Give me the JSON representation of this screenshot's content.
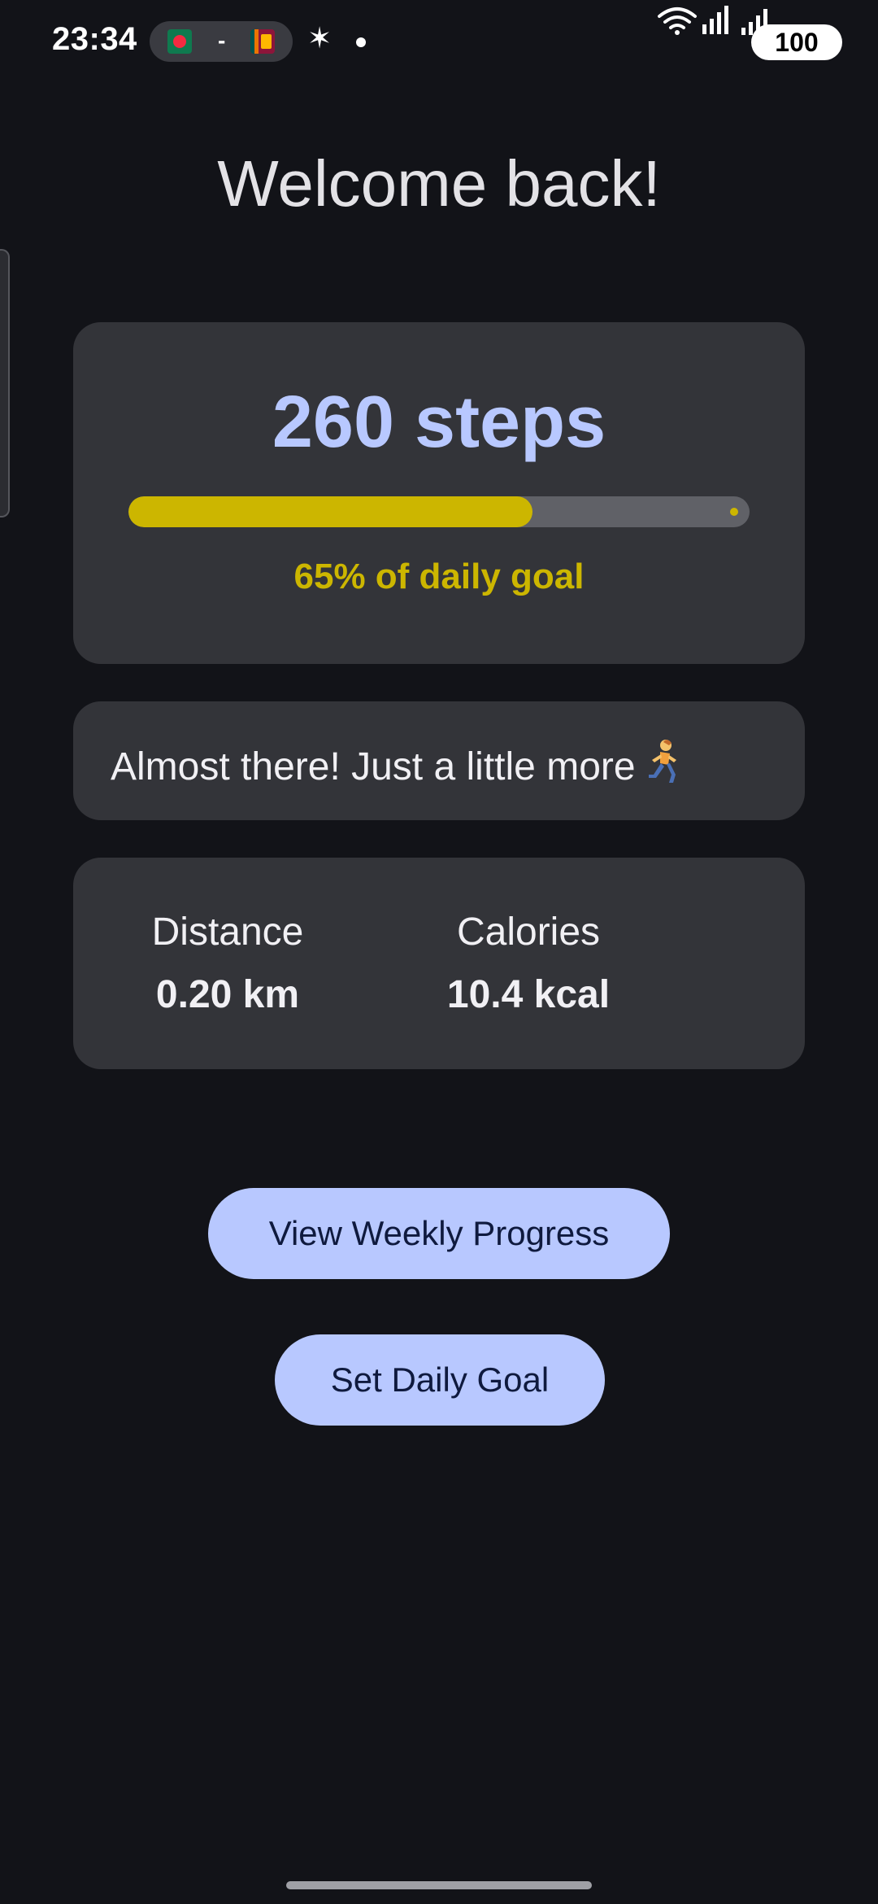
{
  "status_bar": {
    "time": "23:34",
    "separator": "-",
    "battery": "100",
    "icons": [
      "bangladesh-flag-icon",
      "sri-lanka-flag-icon",
      "sparkle-icon",
      "notification-dot-icon",
      "wifi-icon",
      "signal-icon",
      "signal-icon",
      "battery-icon"
    ]
  },
  "header": {
    "title": "Welcome back!"
  },
  "steps_card": {
    "steps": "260 steps",
    "progress_percent": 65,
    "goal_text": "65% of daily goal",
    "accent_color": "#ccb600",
    "steps_color": "#b8c8ff"
  },
  "message_card": {
    "text": "Almost there! Just a little more",
    "icon": "runner-icon"
  },
  "stats_card": {
    "distance_label": "Distance",
    "distance_value": "0.20 km",
    "calories_label": "Calories",
    "calories_value": "10.4 kcal"
  },
  "actions": {
    "weekly_progress_label": "View Weekly Progress",
    "set_goal_label": "Set Daily Goal",
    "button_color": "#b8c8ff"
  },
  "theme": {
    "background": "#121318",
    "card": "#333439"
  }
}
